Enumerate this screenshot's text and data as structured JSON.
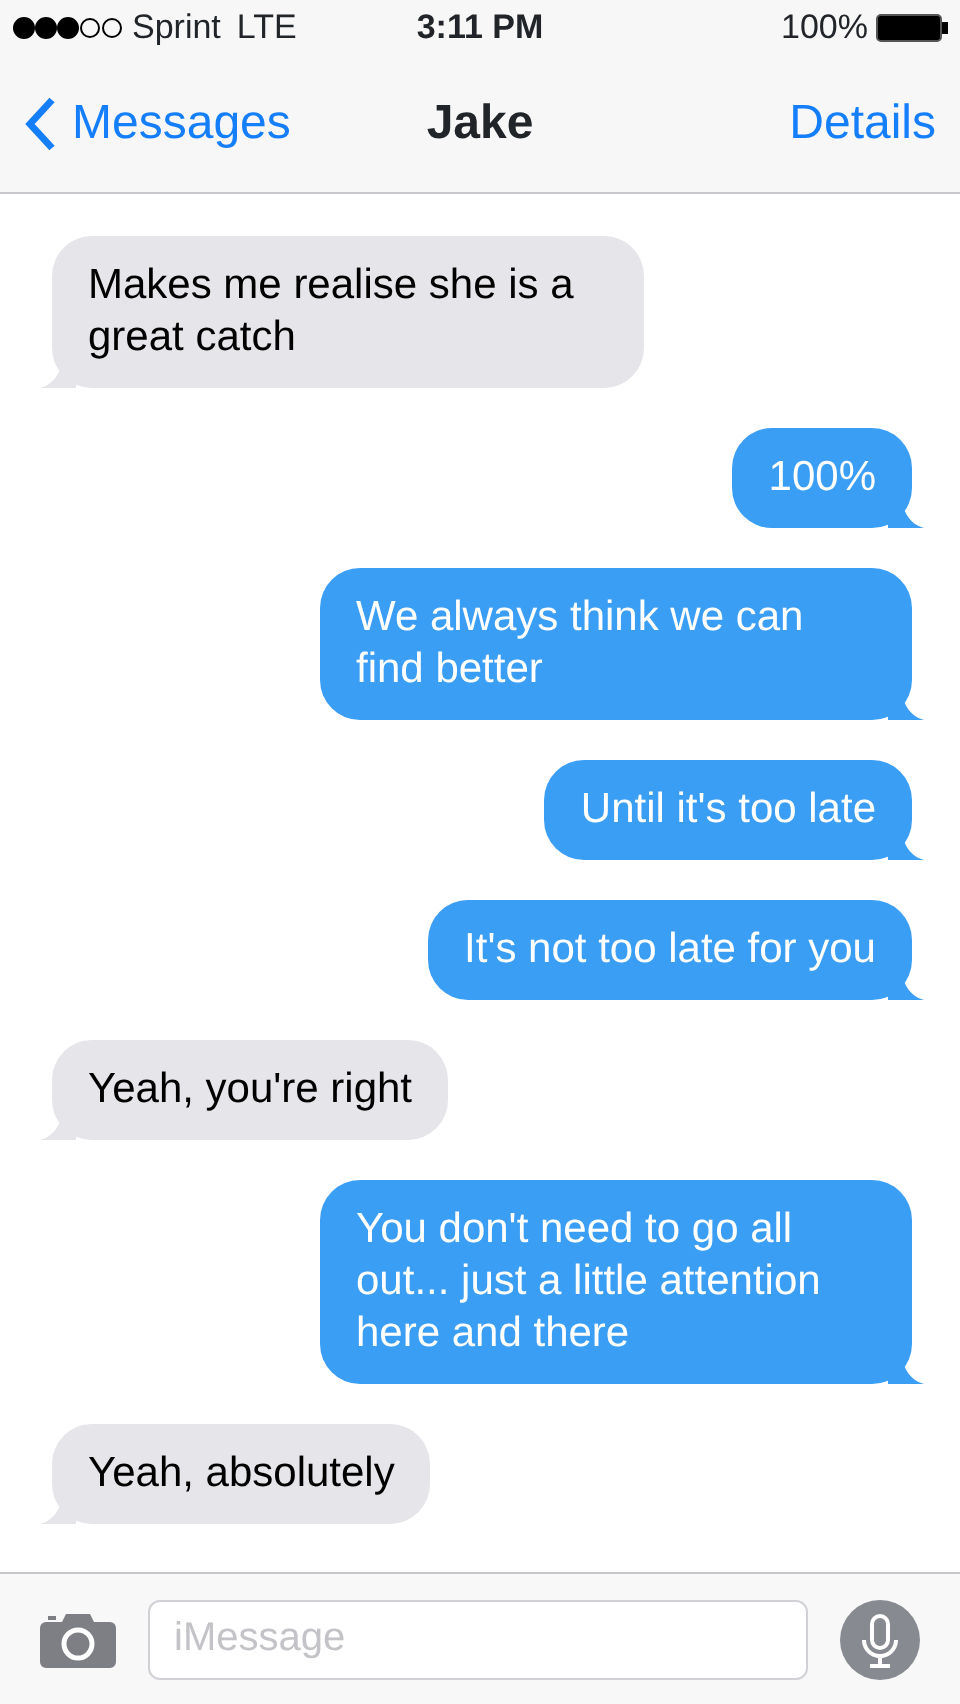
{
  "status_bar": {
    "carrier": "Sprint",
    "network": "LTE",
    "time": "3:11 PM",
    "battery": "100%"
  },
  "nav": {
    "back": "Messages",
    "title": "Jake",
    "action": "Details"
  },
  "messages": [
    {
      "kind": "received",
      "text": "Makes me realise she is a great catch"
    },
    {
      "kind": "sent",
      "text": "100%"
    },
    {
      "kind": "sent",
      "text": "We always think we can find better"
    },
    {
      "kind": "sent",
      "text": "Until it's too late"
    },
    {
      "kind": "sent",
      "text": "It's not too late for you"
    },
    {
      "kind": "received",
      "text": "Yeah, you're right"
    },
    {
      "kind": "sent",
      "text": "You don't need to go all out... just a little attention here and there"
    },
    {
      "kind": "received",
      "text": "Yeah, absolutely"
    }
  ],
  "composer": {
    "placeholder": "iMessage"
  }
}
